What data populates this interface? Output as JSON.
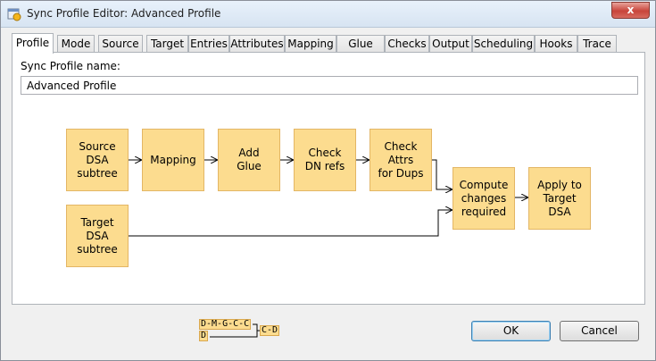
{
  "window": {
    "title": "Sync Profile Editor: Advanced Profile",
    "close_label": "x"
  },
  "tabs": [
    {
      "label": "Profile",
      "active": true
    },
    {
      "label": "Mode"
    },
    {
      "label": "Source"
    },
    {
      "label": "Target"
    },
    {
      "label": "Entries"
    },
    {
      "label": "Attributes"
    },
    {
      "label": "Mapping"
    },
    {
      "label": "Glue"
    },
    {
      "label": "Checks"
    },
    {
      "label": "Output"
    },
    {
      "label": "Scheduling"
    },
    {
      "label": "Hooks"
    },
    {
      "label": "Trace"
    }
  ],
  "profile": {
    "name_label": "Sync Profile name:",
    "name_value": "Advanced Profile"
  },
  "diagram": {
    "nodes": [
      {
        "id": "source",
        "label": "Source\nDSA\nsubtree"
      },
      {
        "id": "mapping",
        "label": "Mapping"
      },
      {
        "id": "glue",
        "label": "Add\nGlue"
      },
      {
        "id": "dnrefs",
        "label": "Check\nDN refs"
      },
      {
        "id": "dups",
        "label": "Check\nAttrs\nfor Dups"
      },
      {
        "id": "target",
        "label": "Target\nDSA\nsubtree"
      },
      {
        "id": "compute",
        "label": "Compute\nchanges\nrequired"
      },
      {
        "id": "apply",
        "label": "Apply to\nTarget\nDSA"
      }
    ],
    "colors": {
      "node_fill": "#fcdc8f",
      "node_border": "#e3b665"
    }
  },
  "mini_map": {
    "top_row": "D-M-G-C-C",
    "right": "C-D",
    "bottom": "D"
  },
  "buttons": {
    "ok": "OK",
    "cancel": "Cancel"
  }
}
